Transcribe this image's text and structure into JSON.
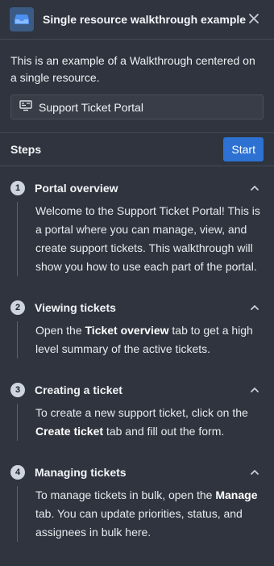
{
  "header": {
    "title": "Single resource walkthrough example",
    "icon": "inbox-icon",
    "close_icon": "close-icon"
  },
  "description": "This is an example of a Walkthrough centered on a single resource.",
  "resource": {
    "icon": "application-icon",
    "label": "Support Ticket Portal"
  },
  "steps_bar": {
    "title": "Steps",
    "start_label": "Start"
  },
  "steps": [
    {
      "number": "1",
      "title": "Portal overview",
      "body": [
        {
          "text": "Welcome to the Support Ticket Portal! This is a portal where you can manage, view, and create support tickets. This walkthrough will show you how to use each part of the portal."
        }
      ]
    },
    {
      "number": "2",
      "title": "Viewing tickets",
      "body": [
        {
          "text": "Open the "
        },
        {
          "text": "Ticket overview",
          "bold": true
        },
        {
          "text": " tab to get a high level summary of the active tickets."
        }
      ]
    },
    {
      "number": "3",
      "title": "Creating a ticket",
      "body": [
        {
          "text": "To create a new support ticket, click on the "
        },
        {
          "text": "Create ticket",
          "bold": true
        },
        {
          "text": " tab and fill out the form."
        }
      ]
    },
    {
      "number": "4",
      "title": "Managing tickets",
      "body": [
        {
          "text": "To manage tickets in bulk, open the "
        },
        {
          "text": "Manage",
          "bold": true
        },
        {
          "text": " tab. You can update priorities, status, and assignees in bulk here."
        }
      ]
    }
  ],
  "colors": {
    "background": "#2f343e",
    "accent": "#2d72d2"
  }
}
